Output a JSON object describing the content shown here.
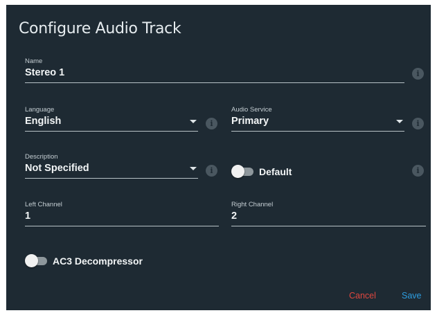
{
  "dialog": {
    "title": "Configure Audio Track",
    "name": {
      "label": "Name",
      "value": "Stereo 1"
    },
    "language": {
      "label": "Language",
      "value": "English"
    },
    "audio_service": {
      "label": "Audio Service",
      "value": "Primary"
    },
    "description": {
      "label": "Description",
      "value": "Not Specified"
    },
    "default_toggle": {
      "label": "Default",
      "checked": false
    },
    "left_channel": {
      "label": "Left Channel",
      "value": "1"
    },
    "right_channel": {
      "label": "Right Channel",
      "value": "2"
    },
    "ac3_toggle": {
      "label": "AC3 Decompressor",
      "checked": false
    },
    "info_icon_glyph": "i",
    "cancel_label": "Cancel",
    "save_label": "Save"
  },
  "colors": {
    "dialog_background": "#1e2a33",
    "cancel": "#e0473f",
    "save": "#2d9de0",
    "underline": "#b9c3c8"
  },
  "icons": {
    "info": "info-icon",
    "dropdown": "chevron-down-icon"
  }
}
